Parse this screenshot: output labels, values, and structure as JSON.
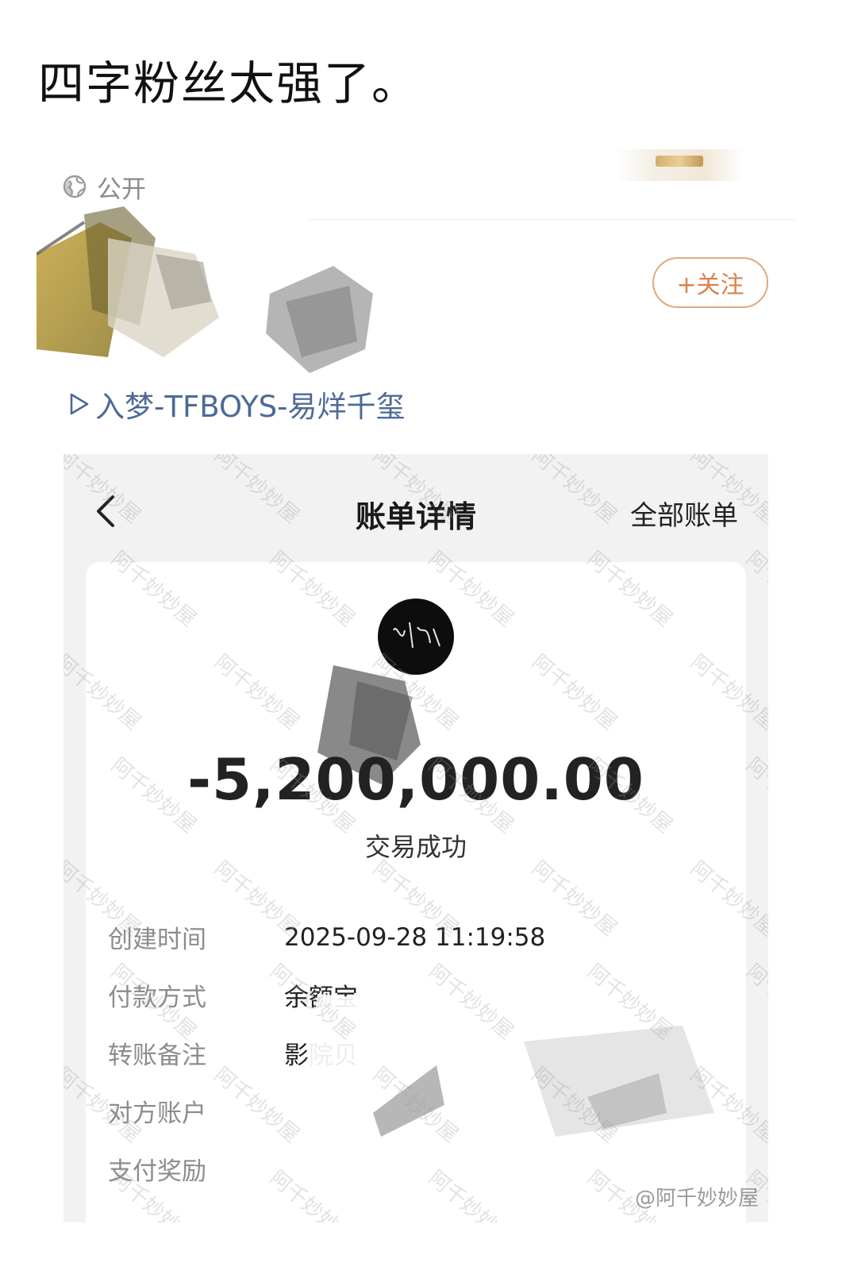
{
  "post": {
    "text": "四字粉丝太强了。",
    "visibility": "公开",
    "follow_label": "+关注",
    "music_tag": "入梦-TFBOYS-易烊千玺"
  },
  "bill": {
    "title": "账单详情",
    "all_bills": "全部账单",
    "amount": "-5,200,000.00",
    "status": "交易成功",
    "rows": [
      {
        "label": "创建时间",
        "value": "2025-09-28 11:19:58"
      },
      {
        "label": "付款方式",
        "value": "余额宝"
      },
      {
        "label": "转账备注",
        "value": "影院贝"
      },
      {
        "label": "对方账户",
        "value": ""
      },
      {
        "label": "支付奖励",
        "value": ""
      }
    ],
    "watermark": "阿千妙妙屋",
    "credit": "@阿千妙妙屋"
  },
  "colors": {
    "follow_accent": "#d8824a",
    "music_link": "#4d6a96"
  }
}
